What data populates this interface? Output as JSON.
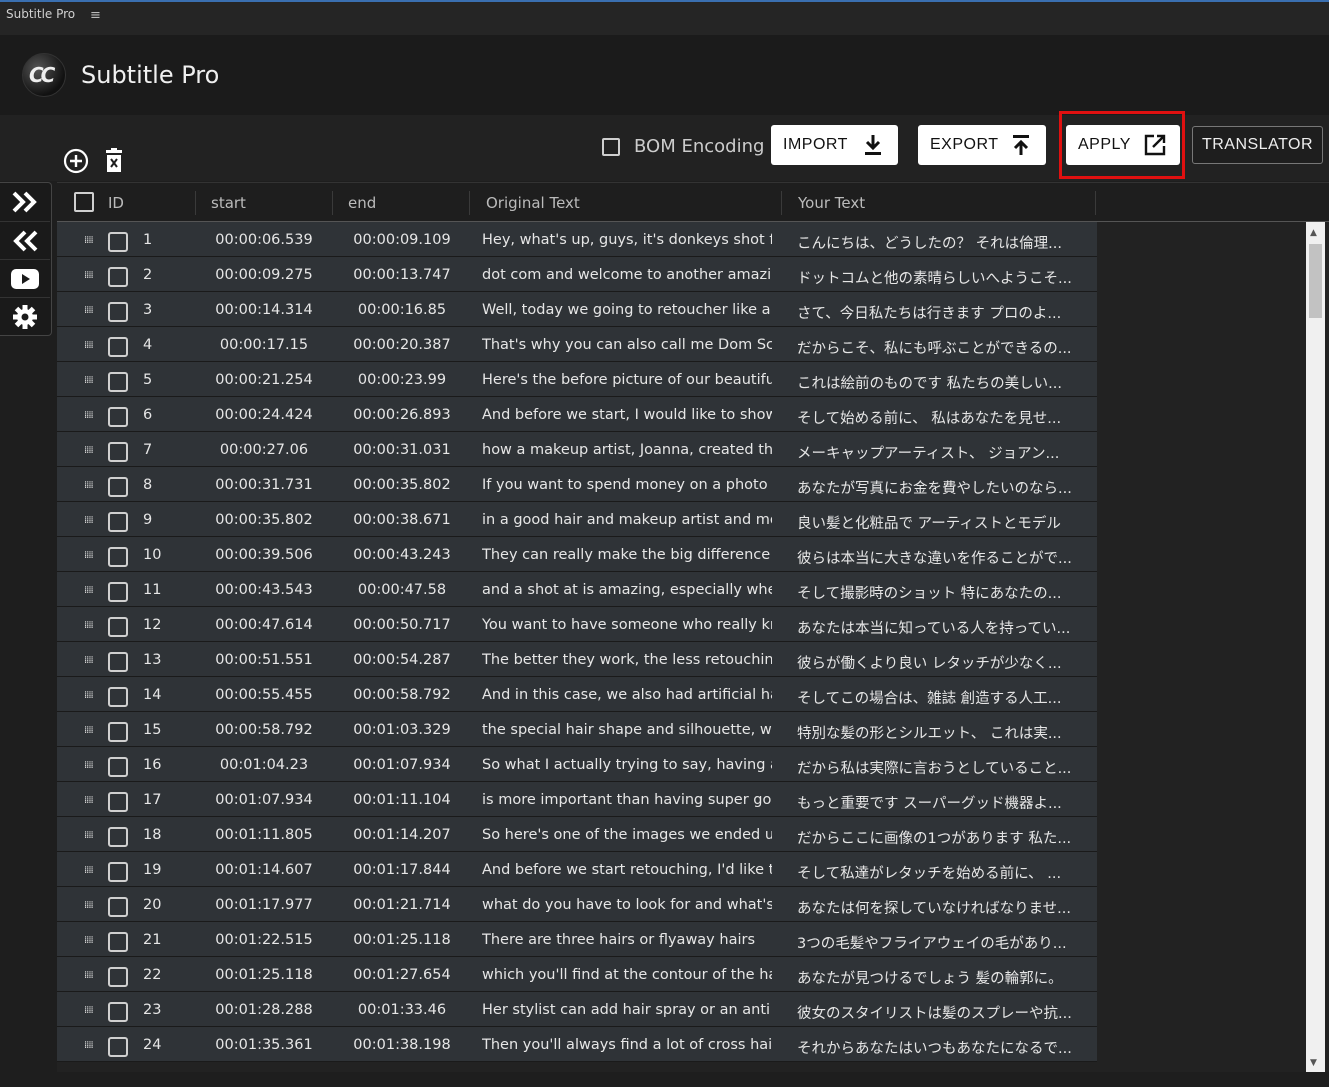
{
  "titlebar": {
    "title": "Subtitle Pro",
    "menu_icon": "≡"
  },
  "header": {
    "title": "Subtitle Pro",
    "logo_text": "CC"
  },
  "toolbar": {
    "bom_label": "BOM Encoding",
    "import_label": "IMPORT",
    "export_label": "EXPORT",
    "apply_label": "APPLY",
    "translator_label": "TRANSLATOR"
  },
  "sidebar": {
    "items": [
      "expand-icon",
      "collapse-icon",
      "youtube-icon",
      "gear-icon"
    ]
  },
  "table": {
    "columns": [
      "ID",
      "start",
      "end",
      "Original Text",
      "Your Text"
    ],
    "rows": [
      {
        "id": "1",
        "start": "00:00:06.539",
        "end": "00:00:09.109",
        "orig": "Hey, what's up, guys, it's donkeys shot for...",
        "your": "こんにちは、どうしたの？ それは倫理..."
      },
      {
        "id": "2",
        "start": "00:00:09.275",
        "end": "00:00:13.747",
        "orig": "dot com and welcome to another amazi...",
        "your": "ドットコムと他の素晴らしいへようこそ..."
      },
      {
        "id": "3",
        "start": "00:00:14.314",
        "end": "00:00:16.85",
        "orig": "Well, today we going to retoucher like a ...",
        "your": "さて、今日私たちは行きます プロのよ..."
      },
      {
        "id": "4",
        "start": "00:00:17.15",
        "end": "00:00:20.387",
        "orig": "That's why you can also call me Dom Sci...",
        "your": "だからこそ、私にも呼ぶことができるの..."
      },
      {
        "id": "5",
        "start": "00:00:21.254",
        "end": "00:00:23.99",
        "orig": "Here's the before picture of our beautiful...",
        "your": "これは絵前のものです 私たちの美しい..."
      },
      {
        "id": "6",
        "start": "00:00:24.424",
        "end": "00:00:26.893",
        "orig": "And before we start, I would like to show...",
        "your": "そして始める前に、 私はあなたを見せ..."
      },
      {
        "id": "7",
        "start": "00:00:27.06",
        "end": "00:00:31.031",
        "orig": "how a makeup artist, Joanna, created this...",
        "your": "メーキャップアーティスト、 ジョアン..."
      },
      {
        "id": "8",
        "start": "00:00:31.731",
        "end": "00:00:35.802",
        "orig": "If you want to spend money on a photo s...",
        "your": "あなたが写真にお金を費やしたいのなら..."
      },
      {
        "id": "9",
        "start": "00:00:35.802",
        "end": "00:00:38.671",
        "orig": "in a good hair and makeup artist and mo...",
        "your": " 良い髪と化粧品で アーティストとモデル"
      },
      {
        "id": "10",
        "start": "00:00:39.506",
        "end": "00:00:43.243",
        "orig": "They can really make the big difference ...",
        "your": "彼らは本当に大きな違いを作ることがで..."
      },
      {
        "id": "11",
        "start": "00:00:43.543",
        "end": "00:00:47.58",
        "orig": "and a shot at is amazing, especially whe...",
        "your": "そして撮影時のショット 特にあなたの..."
      },
      {
        "id": "12",
        "start": "00:00:47.614",
        "end": "00:00:50.717",
        "orig": "You want to have someone who really kn...",
        "your": "あなたは本当に知っている人を持ってい..."
      },
      {
        "id": "13",
        "start": "00:00:51.551",
        "end": "00:00:54.287",
        "orig": "The better they work, the less retouching ...",
        "your": "彼らが働くより良い レタッチが少なく..."
      },
      {
        "id": "14",
        "start": "00:00:55.455",
        "end": "00:00:58.792",
        "orig": "And in this case, we also had artificial hai...",
        "your": "そしてこの場合は、雑誌 創造する人工..."
      },
      {
        "id": "15",
        "start": "00:00:58.792",
        "end": "00:01:03.329",
        "orig": "the special hair shape and silhouette, whi...",
        "your": "特別な髪の形とシルエット、 これは実..."
      },
      {
        "id": "16",
        "start": "00:01:04.23",
        "end": "00:01:07.934",
        "orig": "So what I actually trying to say, having a ...",
        "your": "だから私は実際に言おうとしていること..."
      },
      {
        "id": "17",
        "start": "00:01:07.934",
        "end": "00:01:11.104",
        "orig": "is more important than having super goo...",
        "your": "もっと重要です スーパーグッド機器よ..."
      },
      {
        "id": "18",
        "start": "00:01:11.805",
        "end": "00:01:14.207",
        "orig": "So here's one of the images we ended u...",
        "your": "だからここに画像の1つがあります 私た..."
      },
      {
        "id": "19",
        "start": "00:01:14.607",
        "end": "00:01:17.844",
        "orig": "And before we start retouching, I'd like t...",
        "your": "そして私達がレタッチを始める前に、 ..."
      },
      {
        "id": "20",
        "start": "00:01:17.977",
        "end": "00:01:21.714",
        "orig": "what do you have to look for and what's ...",
        "your": "あなたは何を探していなければなりませ..."
      },
      {
        "id": "21",
        "start": "00:01:22.515",
        "end": "00:01:25.118",
        "orig": "   There are three hairs or flyaway hairs",
        "your": "3つの毛髪やフライアウェイの毛があり..."
      },
      {
        "id": "22",
        "start": "00:01:25.118",
        "end": "00:01:27.654",
        "orig": " which you'll find at the contour of the hair.",
        "your": " あなたが見つけるでしょう 髪の輪郭に。"
      },
      {
        "id": "23",
        "start": "00:01:28.288",
        "end": "00:01:33.46",
        "orig": "Her stylist can add hair spray or an anti s...",
        "your": "彼女のスタイリストは髪のスプレーや抗..."
      },
      {
        "id": "24",
        "start": "00:01:35.361",
        "end": "00:01:38.198",
        "orig": " Then you'll always find a lot of cross hairs.",
        "your": "それからあなたはいつもあなたになるで..."
      }
    ]
  }
}
